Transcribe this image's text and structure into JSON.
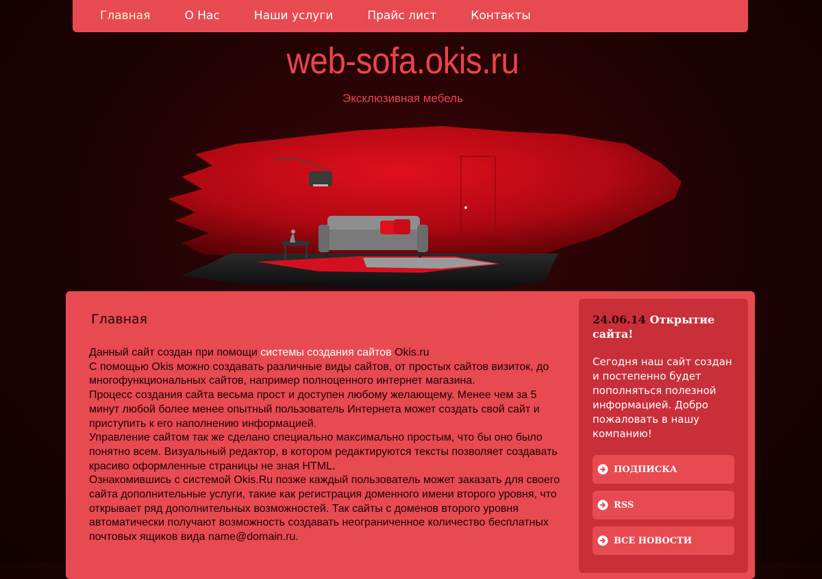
{
  "nav": {
    "items": [
      "Главная",
      "О Нас",
      "Наши услуги",
      "Прайс лист",
      "Контакты"
    ]
  },
  "header": {
    "title": "web-sofa.okis.ru",
    "tagline": "Эксклюзивная мебель"
  },
  "main": {
    "heading": "Главная",
    "p1_before": "Данный сайт создан при помощи ",
    "p1_link": "системы создания сайтов",
    "p1_after": " Okis.ru",
    "p2": "С помощью Okis можно создавать различные виды сайтов, от простых сайтов визиток, до многофункциональных сайтов, например полноценного интернет магазина.",
    "p3": "Процесс создания сайта весьма прост и доступен любому желающему. Менее чем за 5 минут любой более менее опытный пользователь Интернета может создать свой сайт и приступить к его наполнению информацией.",
    "p4": "Управление сайтом так же сделано специально максимально простым, что бы оно было понятно всем. Визуальный редактор, в котором редактируются тексты позволяет создавать красиво оформленные страницы не зная HTML.",
    "p5": "Ознакомившись с системой Okis.Ru позже каждый пользователь может заказать для своего сайта дополнительные услуги, такие как регистрация доменного имени второго уровня, что открывает ряд дополнительных возможностей. Так сайты с доменов второго уровня автоматически получают возможность создавать неограниченное количество бесплатных почтовых ящиков вида name@domain.ru."
  },
  "sidebar": {
    "news_date": "24.06.14",
    "news_title": "Открытие сайта!",
    "news_text": "Сегодня наш сайт создан и постепенно будет пополняться полезной информацией. Добро пожаловать в нашу компанию!",
    "buttons": [
      "ПОДПИСКА",
      "RSS",
      "ВСЕ НОВОСТИ"
    ],
    "button_icon": "arrow-circle-right-icon"
  },
  "colors": {
    "accent": "#e84a51",
    "sidebar": "#c92f39",
    "background": "#1e0204"
  }
}
